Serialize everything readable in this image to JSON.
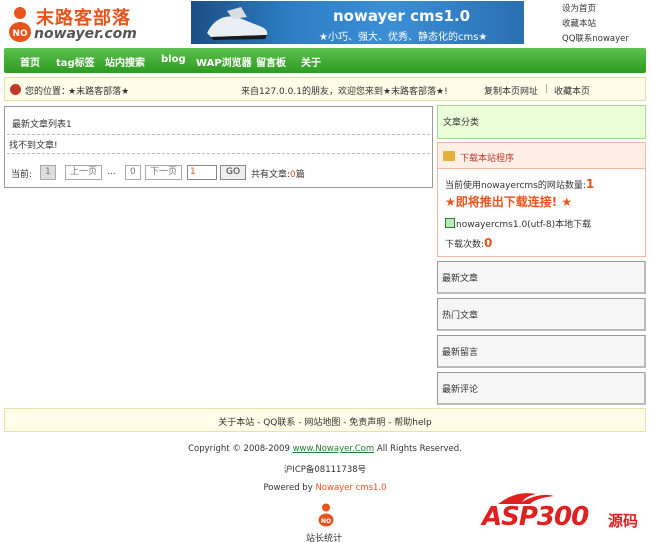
{
  "header": {
    "logo_cn": "末路客部落",
    "logo_en": "nowayer.com",
    "banner_title": "nowayer cms1.0",
    "banner_subtitle": "★小巧、强大、优秀、静态化的cms★",
    "top_links": [
      "设为首页",
      "收藏本站",
      "QQ联系nowayer"
    ]
  },
  "nav": {
    "items": [
      "首页",
      "tag标签",
      "站内搜索",
      "blog",
      "WAP浏览器",
      "留言板",
      "关于"
    ]
  },
  "location": {
    "label": "您的位置：",
    "site": "★末路客部落★",
    "welcome": "来自127.0.0.1的朋友，欢迎您来到★末路客部落★!",
    "copy_link": "复制本页网址",
    "separator": "|",
    "bookmark": "收藏本页"
  },
  "main": {
    "list_title": "最新文章列表1",
    "empty_text": "找不到文章!",
    "pager": {
      "current_label": "当前:",
      "current_page": "1",
      "prev": "上一页",
      "ellipsis": "...",
      "last_page": "0",
      "next": "下一页",
      "page_input": "1",
      "go": "GO",
      "total_prefix": "共有文章:",
      "total_count": "0",
      "total_suffix": "篇"
    }
  },
  "sidebar": {
    "category_title": "文章分类",
    "download": {
      "title": "下载本站程序",
      "using_prefix": "当前使用nowayercms的网站数量:",
      "using_count": "1",
      "coming": "★即将推出下载连接! ★",
      "file_name": "nowayercms1.0(utf-8)本地下载",
      "downloads_label": "下载次数:",
      "downloads_count": "0"
    },
    "boxes": [
      "最新文章",
      "热门文章",
      "最新留言",
      "最新评论"
    ]
  },
  "footer": {
    "links": "关于本站 - QQ联系 - 网站地图 - 免责声明 - 帮助help",
    "copyright_prefix": "Copyright © 2008-2009 ",
    "copyright_link": "www.Nowayer.Com",
    "copyright_suffix": " All Rights Reserved.",
    "icp": "沪ICP备08111738号",
    "powered_prefix": "Powered by ",
    "powered_name": "Nowayer cms1.0",
    "stat": "站长统计"
  },
  "watermark": {
    "text": "ASP300",
    "cn": "源码"
  },
  "colors": {
    "nav_green": "#3aa62c",
    "accent_orange": "#e8541b",
    "link_green": "#2a7d2a"
  }
}
